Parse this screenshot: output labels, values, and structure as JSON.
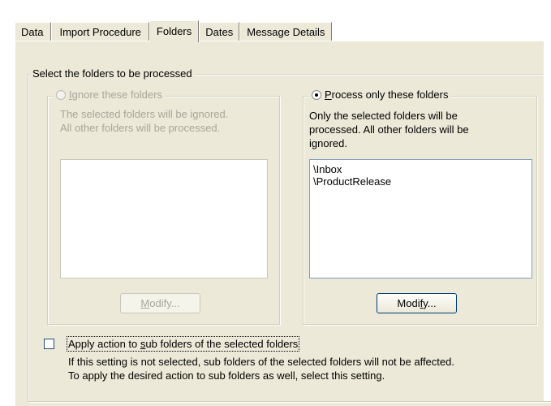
{
  "tabs": [
    {
      "label": "Data",
      "active": false
    },
    {
      "label": "Import Procedure",
      "active": false
    },
    {
      "label": "Folders",
      "active": true
    },
    {
      "label": "Dates",
      "active": false
    },
    {
      "label": "Message Details",
      "active": false
    }
  ],
  "outer_group": {
    "legend": "Select the folders to be processed"
  },
  "ignore_group": {
    "label_prefix": "",
    "label_access": "I",
    "label_rest": "gnore these folders",
    "selected": false,
    "enabled": false,
    "desc_line1": "The selected folders will be ignored.",
    "desc_line2": "All other folders will be processed.",
    "items": [],
    "modify_access": "M",
    "modify_rest": "odify..."
  },
  "process_group": {
    "label_access": "P",
    "label_rest": "rocess only these folders",
    "selected": true,
    "enabled": true,
    "desc_line1": "Only the selected folders will be",
    "desc_line2": "processed. All other folders will be",
    "desc_line3": "ignored.",
    "items": [
      "\\Inbox",
      "\\ProductRelease"
    ],
    "modify_prefix": "Modi",
    "modify_access": "f",
    "modify_rest": "y..."
  },
  "subfolders": {
    "label_prefix": "Apply action to ",
    "label_access": "s",
    "label_rest": "ub folders of the selected folders",
    "checked": false,
    "help_line1": "If this setting is not selected, sub folders of the selected folders will not be affected.",
    "help_line2": "To apply the desired action to sub folders as well, select this setting."
  },
  "colors": {
    "face": "#ece9d8",
    "list_border": "#7f9db9",
    "disabled_text": "#a7a69a"
  }
}
